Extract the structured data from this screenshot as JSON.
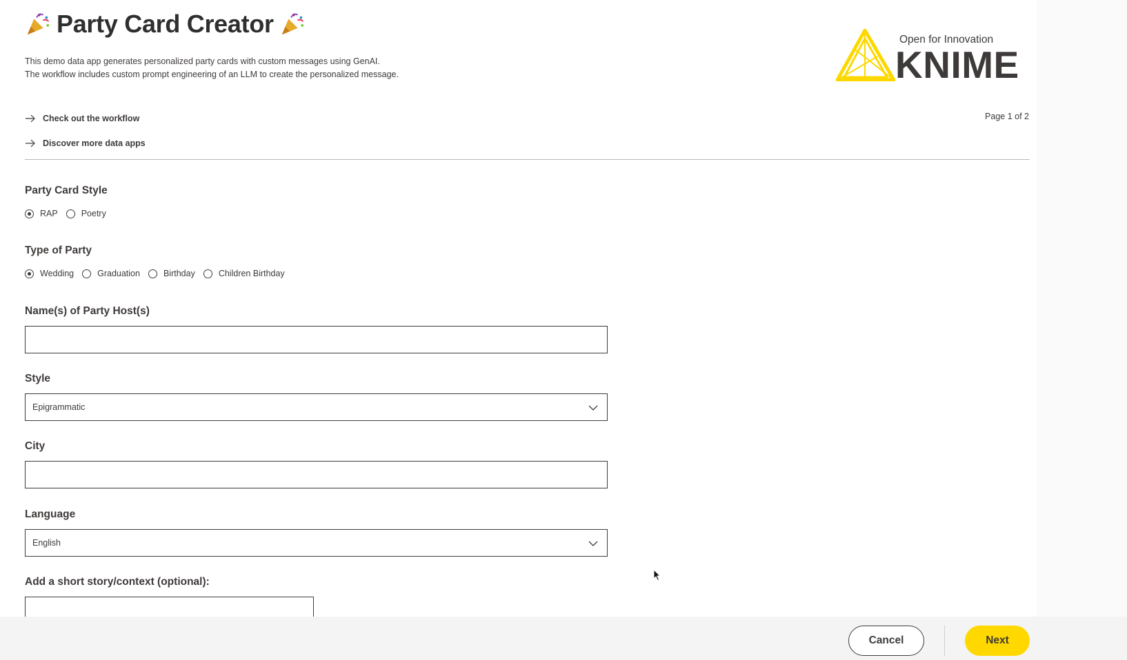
{
  "header": {
    "title": "Party Card Creator",
    "description_line1": "This demo data app generates personalized party cards with custom messages using GenAI.",
    "description_line2": "The workflow includes custom prompt engineering of an LLM to create the personalized message.",
    "title_icon": "party-popper-icon"
  },
  "logo": {
    "tagline": "Open for Innovation",
    "wordmark": "KNIME",
    "color": "#fdd800"
  },
  "links": {
    "workflow": "Check out the workflow",
    "more_apps": "Discover more data apps"
  },
  "pagination": {
    "label": "Page 1 of 2"
  },
  "form": {
    "card_style": {
      "label": "Party Card Style",
      "options": [
        "RAP",
        "Poetry"
      ],
      "selected": "RAP"
    },
    "party_type": {
      "label": "Type of Party",
      "options": [
        "Wedding",
        "Graduation",
        "Birthday",
        "Children Birthday"
      ],
      "selected": "Wedding"
    },
    "hosts": {
      "label": "Name(s) of Party Host(s)",
      "value": ""
    },
    "style": {
      "label": "Style",
      "value": "Epigrammatic"
    },
    "city": {
      "label": "City",
      "value": ""
    },
    "language": {
      "label": "Language",
      "value": "English"
    },
    "story": {
      "label": "Add a short story/context (optional):",
      "value": ""
    }
  },
  "footer": {
    "cancel_label": "Cancel",
    "next_label": "Next",
    "next_color": "#ffd800"
  }
}
